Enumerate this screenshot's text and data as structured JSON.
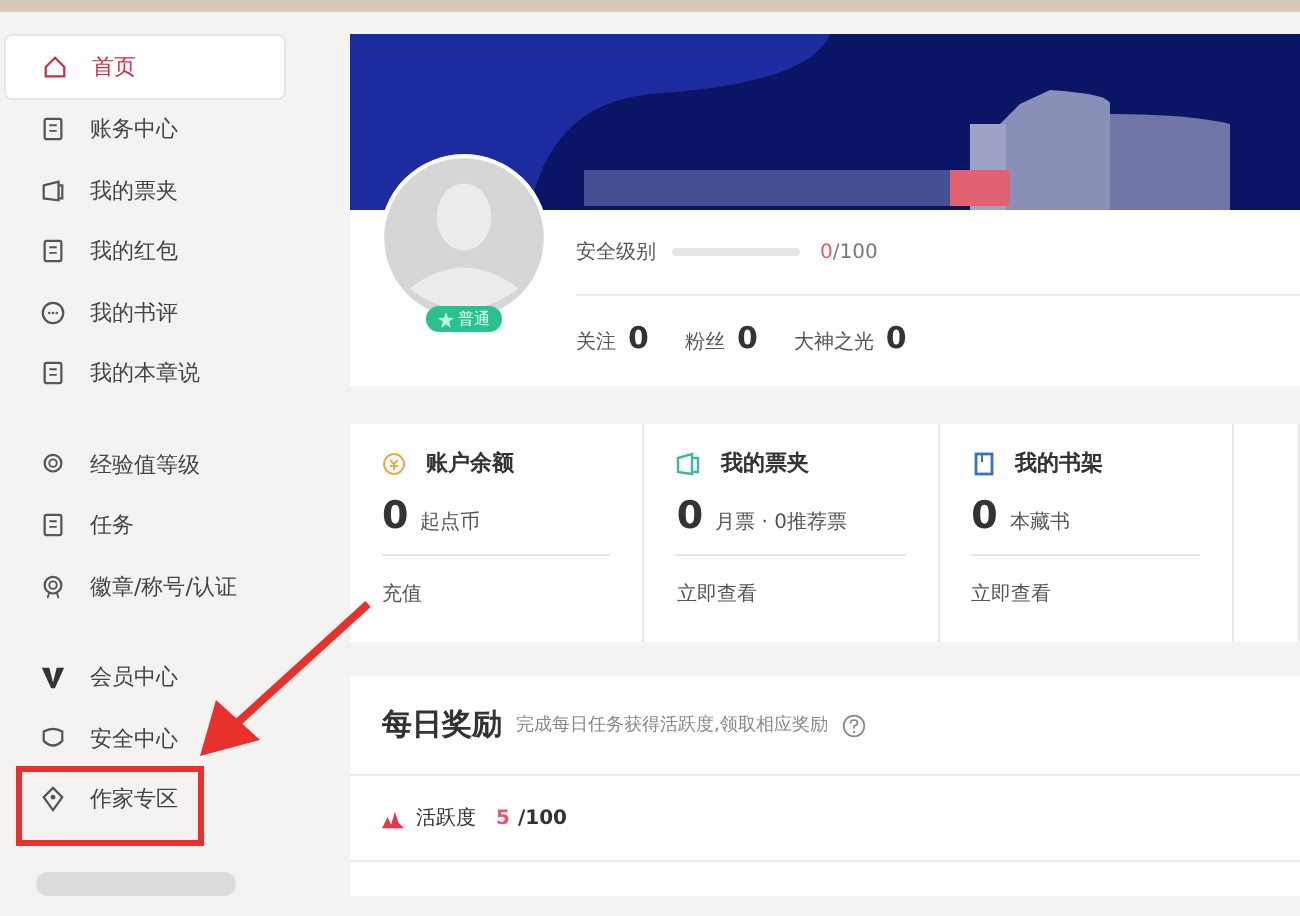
{
  "sidebar": {
    "groups": [
      [
        {
          "label": "首页",
          "selected": true
        },
        {
          "label": "账务中心",
          "selected": false
        },
        {
          "label": "我的票夹",
          "selected": false
        },
        {
          "label": "我的红包",
          "selected": false
        },
        {
          "label": "我的书评",
          "selected": false
        },
        {
          "label": "我的本章说",
          "selected": false
        }
      ],
      [
        {
          "label": "经验值等级",
          "selected": false
        },
        {
          "label": "任务",
          "selected": false
        },
        {
          "label": "徽章/称号/认证",
          "selected": false
        }
      ],
      [
        {
          "label": "会员中心",
          "selected": false
        },
        {
          "label": "安全中心",
          "selected": false
        },
        {
          "label": "作家专区",
          "selected": false
        }
      ]
    ]
  },
  "profile": {
    "badge": "普通",
    "security": {
      "label": "安全级别",
      "level": 0,
      "score": "0",
      "total": "/100"
    },
    "stats": [
      {
        "label": "关注",
        "value": "0"
      },
      {
        "label": "粉丝",
        "value": "0"
      },
      {
        "label": "大神之光",
        "value": "0"
      }
    ]
  },
  "cards": [
    {
      "title": "账户余额",
      "value": "0",
      "unit": "起点币",
      "link": "充值"
    },
    {
      "title": "我的票夹",
      "value": "0",
      "unit": "月票 · 0推荐票",
      "link": "立即查看"
    },
    {
      "title": "我的书架",
      "value": "0",
      "unit": "本藏书",
      "link": "立即查看"
    }
  ],
  "daily": {
    "title": "每日奖励",
    "subtitle": "完成每日任务获得活跃度,领取相应奖励",
    "activity": {
      "label": "活跃度",
      "score": "5",
      "total": "/100"
    }
  }
}
